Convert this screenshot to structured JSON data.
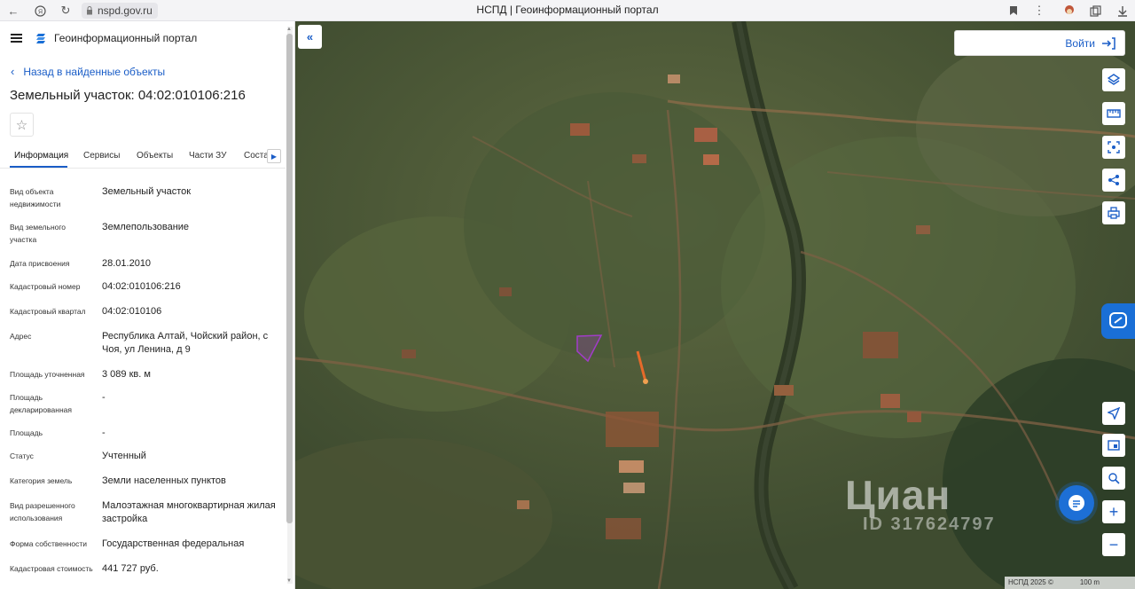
{
  "browser": {
    "url": "nspd.gov.ru",
    "tab_title": "НСПД | Геоинформационный портал"
  },
  "header": {
    "portal_title": "Геоинформационный портал"
  },
  "back_link": "Назад в найденные объекты",
  "parcel_title": "Земельный участок: 04:02:010106:216",
  "tabs": [
    "Информация",
    "Сервисы",
    "Объекты",
    "Части ЗУ",
    "Соста"
  ],
  "attributes": [
    {
      "label": "Вид объекта недвижимости",
      "value": "Земельный участок"
    },
    {
      "label": "Вид земельного участка",
      "value": "Землепользование"
    },
    {
      "label": "Дата присвоения",
      "value": "28.01.2010"
    },
    {
      "label": "Кадастровый номер",
      "value": "04:02:010106:216"
    },
    {
      "label": "Кадастровый квартал",
      "value": "04:02:010106"
    },
    {
      "label": "Адрес",
      "value": "Республика Алтай, Чойский район, с Чоя, ул Ленина, д 9"
    },
    {
      "label": "Площадь уточненная",
      "value": "3 089 кв. м"
    },
    {
      "label": "Площадь декларированная",
      "value": "-"
    },
    {
      "label": "Площадь",
      "value": "-"
    },
    {
      "label": "Статус",
      "value": "Учтенный"
    },
    {
      "label": "Категория земель",
      "value": "Земли населенных пунктов"
    },
    {
      "label": "Вид разрешенного использования",
      "value": "Малоэтажная многоквартирная жилая застройка"
    },
    {
      "label": "Форма собственности",
      "value": "Государственная федеральная"
    },
    {
      "label": "Кадастровая стоимость",
      "value": "441 727 руб."
    }
  ],
  "map": {
    "login_label": "Войти",
    "watermark": "Циан",
    "watermark_id": "ID 317624797",
    "attribution": "НСПД 2025 ©",
    "scale_label": "100 m",
    "tools_top": [
      "layers-icon",
      "ruler-icon",
      "select-area-icon",
      "share-icon",
      "print-icon"
    ],
    "tools_bottom": [
      "locate-icon",
      "minimap-icon",
      "geo-search-icon",
      "zoom-in-icon",
      "zoom-out-icon"
    ]
  },
  "colors": {
    "accent": "#1a5dc7",
    "parcel_outline": "#a23cc9"
  }
}
